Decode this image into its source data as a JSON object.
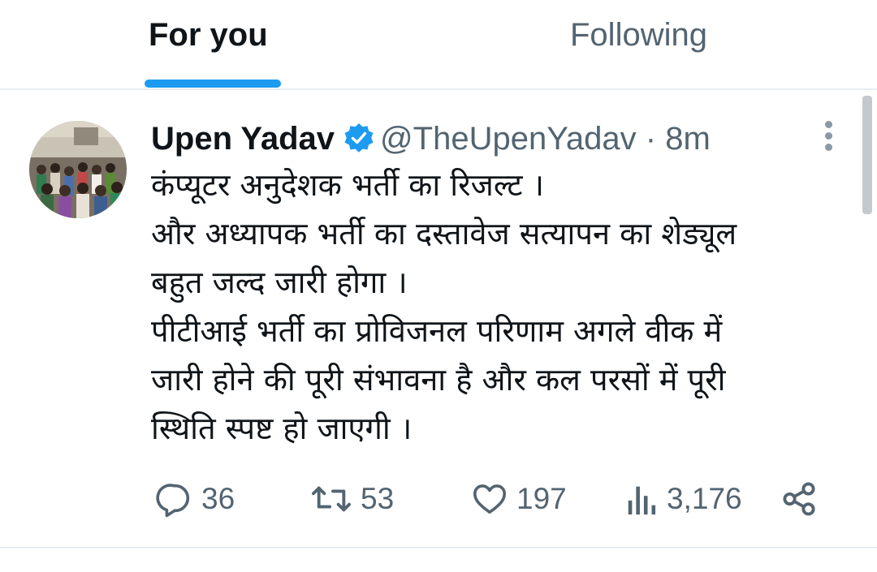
{
  "tabs": {
    "for_you": "For you",
    "following": "Following",
    "active": "For you"
  },
  "tweet": {
    "author_name": "Upen Yadav",
    "verified": true,
    "handle": "@TheUpenYadav",
    "separator": "·",
    "time": "8m",
    "body_lines": [
      "कंप्यूटर अनुदेशक भर्ती का रिजल्ट ।",
      "और अध्यापक भर्ती का दस्तावेज सत्यापन का शेड्यूल",
      "बहुत जल्द जारी होगा ।",
      "पीटीआई भर्ती का प्रोविजनल परिणाम अगले वीक में",
      "जारी होने की पूरी संभावना है और कल परसों में पूरी",
      "स्थिति स्पष्ट हो जाएगी ।"
    ],
    "stats": {
      "replies": "36",
      "retweets": "53",
      "likes": "197",
      "views": "3,176"
    }
  },
  "icons": {
    "avatar": "avatar",
    "verified": "verified-badge-icon",
    "more": "more-options-icon",
    "reply": "reply-icon",
    "retweet": "retweet-icon",
    "like": "heart-icon",
    "views": "views-icon",
    "share": "share-icon"
  },
  "colors": {
    "accent": "#1d9bf0",
    "text_primary": "#0f1419",
    "text_secondary": "#536471",
    "divider": "#e7ecf0"
  }
}
